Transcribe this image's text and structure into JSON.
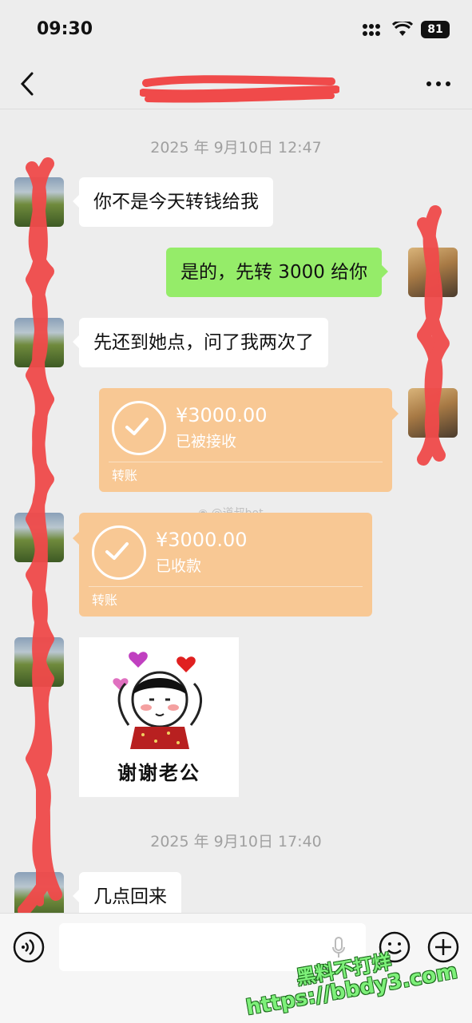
{
  "status": {
    "time": "09:30",
    "battery": "81"
  },
  "nav": {
    "back_icon": "chevron-left-icon",
    "more_icon": "more-dots-icon"
  },
  "timestamps": [
    "2025 年 9月10日 12:47",
    "2025 年 9月10日 17:40"
  ],
  "messages": {
    "m1": "你不是今天转钱给我",
    "m2": "是的，先转 3000 给你",
    "m3": "先还到她点，问了我两次了",
    "m4": "几点回来"
  },
  "transfers": [
    {
      "amount": "¥3000.00",
      "state": "已被接收",
      "label": "转账",
      "side": "right"
    },
    {
      "amount": "¥3000.00",
      "state": "已收款",
      "label": "转账",
      "side": "left"
    }
  ],
  "sticker": {
    "text": "谢谢老公"
  },
  "overlay_watermark": "@道叔bot",
  "site_watermark": {
    "line1": "黑料不打烊",
    "line2": "https://bbdy3.com"
  },
  "colors": {
    "background": "#ededed",
    "bubble_self": "#95ec69",
    "bubble_other": "#ffffff",
    "transfer_card": "#f8c894",
    "redaction": "#f04a4a"
  }
}
